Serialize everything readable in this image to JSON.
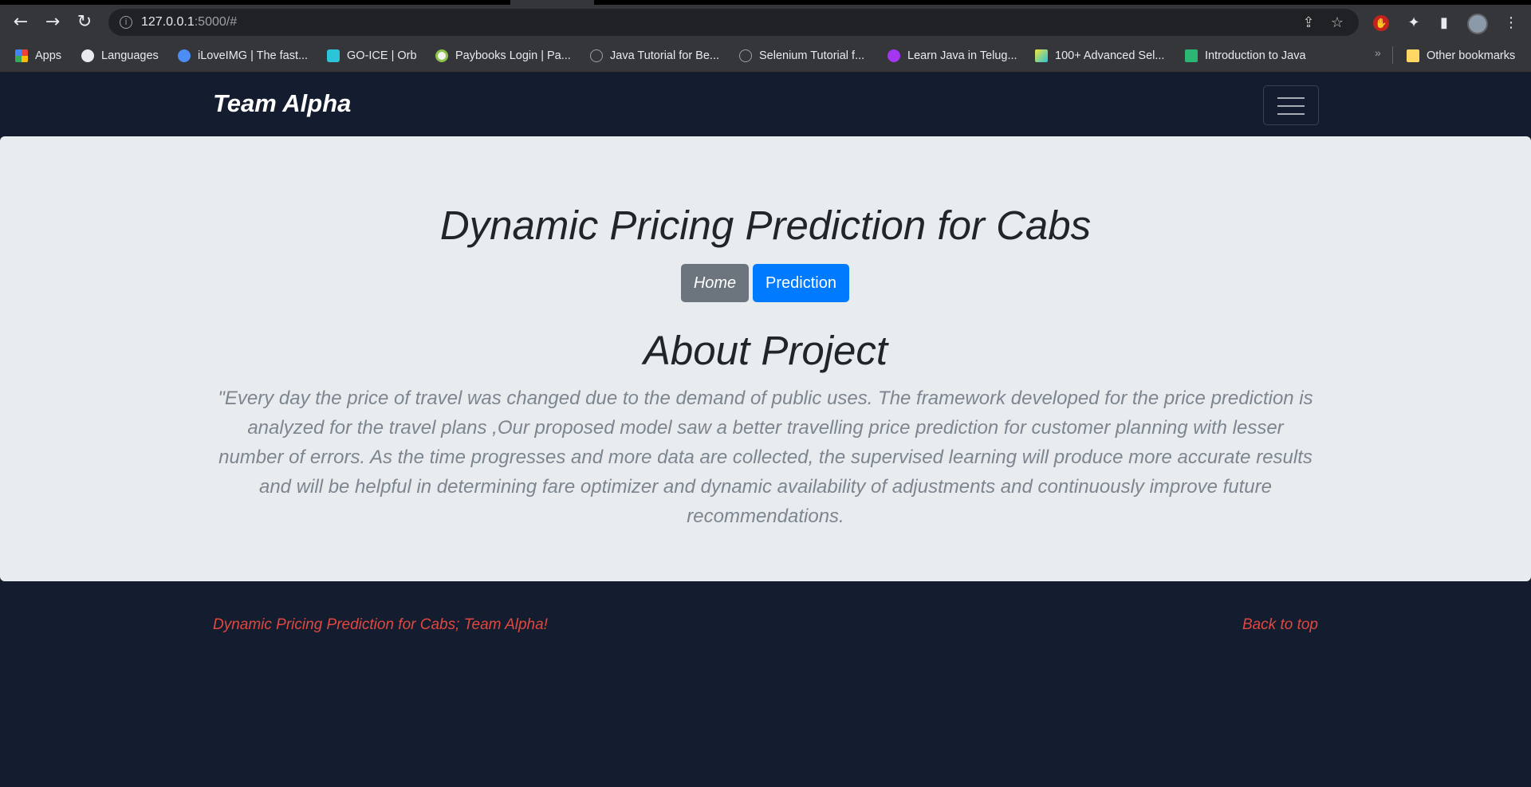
{
  "browser": {
    "url_host": "127.0.0.1",
    "url_rest": ":5000/#",
    "bookmarks": [
      {
        "label": "Apps",
        "icon": "apps-grid-icon",
        "color": "#ea4335"
      },
      {
        "label": "Languages",
        "icon": "gear-icon",
        "color": "#e8eaed"
      },
      {
        "label": "iLoveIMG | The fast...",
        "icon": "heart-icon",
        "color": "#4c8df6"
      },
      {
        "label": "GO-ICE | Orb",
        "icon": "cube-icon",
        "color": "#2bc4d8"
      },
      {
        "label": "Paybooks Login | Pa...",
        "icon": "paybooks-icon",
        "color": "#f2f2f2"
      },
      {
        "label": "Java Tutorial for Be...",
        "icon": "site-icon",
        "color": "#3c3d41"
      },
      {
        "label": "Selenium Tutorial f...",
        "icon": "site-icon",
        "color": "#3c3d41"
      },
      {
        "label": "Learn Java in Telug...",
        "icon": "udemy-icon",
        "color": "#a435f0"
      },
      {
        "label": "100+ Advanced Sel...",
        "icon": "stm-icon",
        "color": "#f1e43a"
      },
      {
        "label": "Introduction to Java",
        "icon": "w-icon",
        "color": "#2bb673"
      }
    ],
    "other_bookmarks": "Other bookmarks"
  },
  "navbar": {
    "brand": "Team Alpha"
  },
  "hero": {
    "title": "Dynamic Pricing Prediction for Cabs",
    "home_button": "Home",
    "prediction_button": "Prediction",
    "about_title": "About Project",
    "about_text": "\"Every day the price of travel was changed due to the demand of public uses. The framework developed for the price prediction is analyzed for the travel plans ,Our proposed model saw a better travelling price prediction for customer planning with lesser number of errors. As the time progresses and more data are collected, the supervised learning will produce more accurate results and will be helpful in determining fare optimizer and dynamic availability of adjustments and continuously improve future recommendations."
  },
  "footer": {
    "left_text": "Dynamic Pricing Prediction for Cabs; Team Alpha!",
    "back_to_top": "Back to top"
  }
}
